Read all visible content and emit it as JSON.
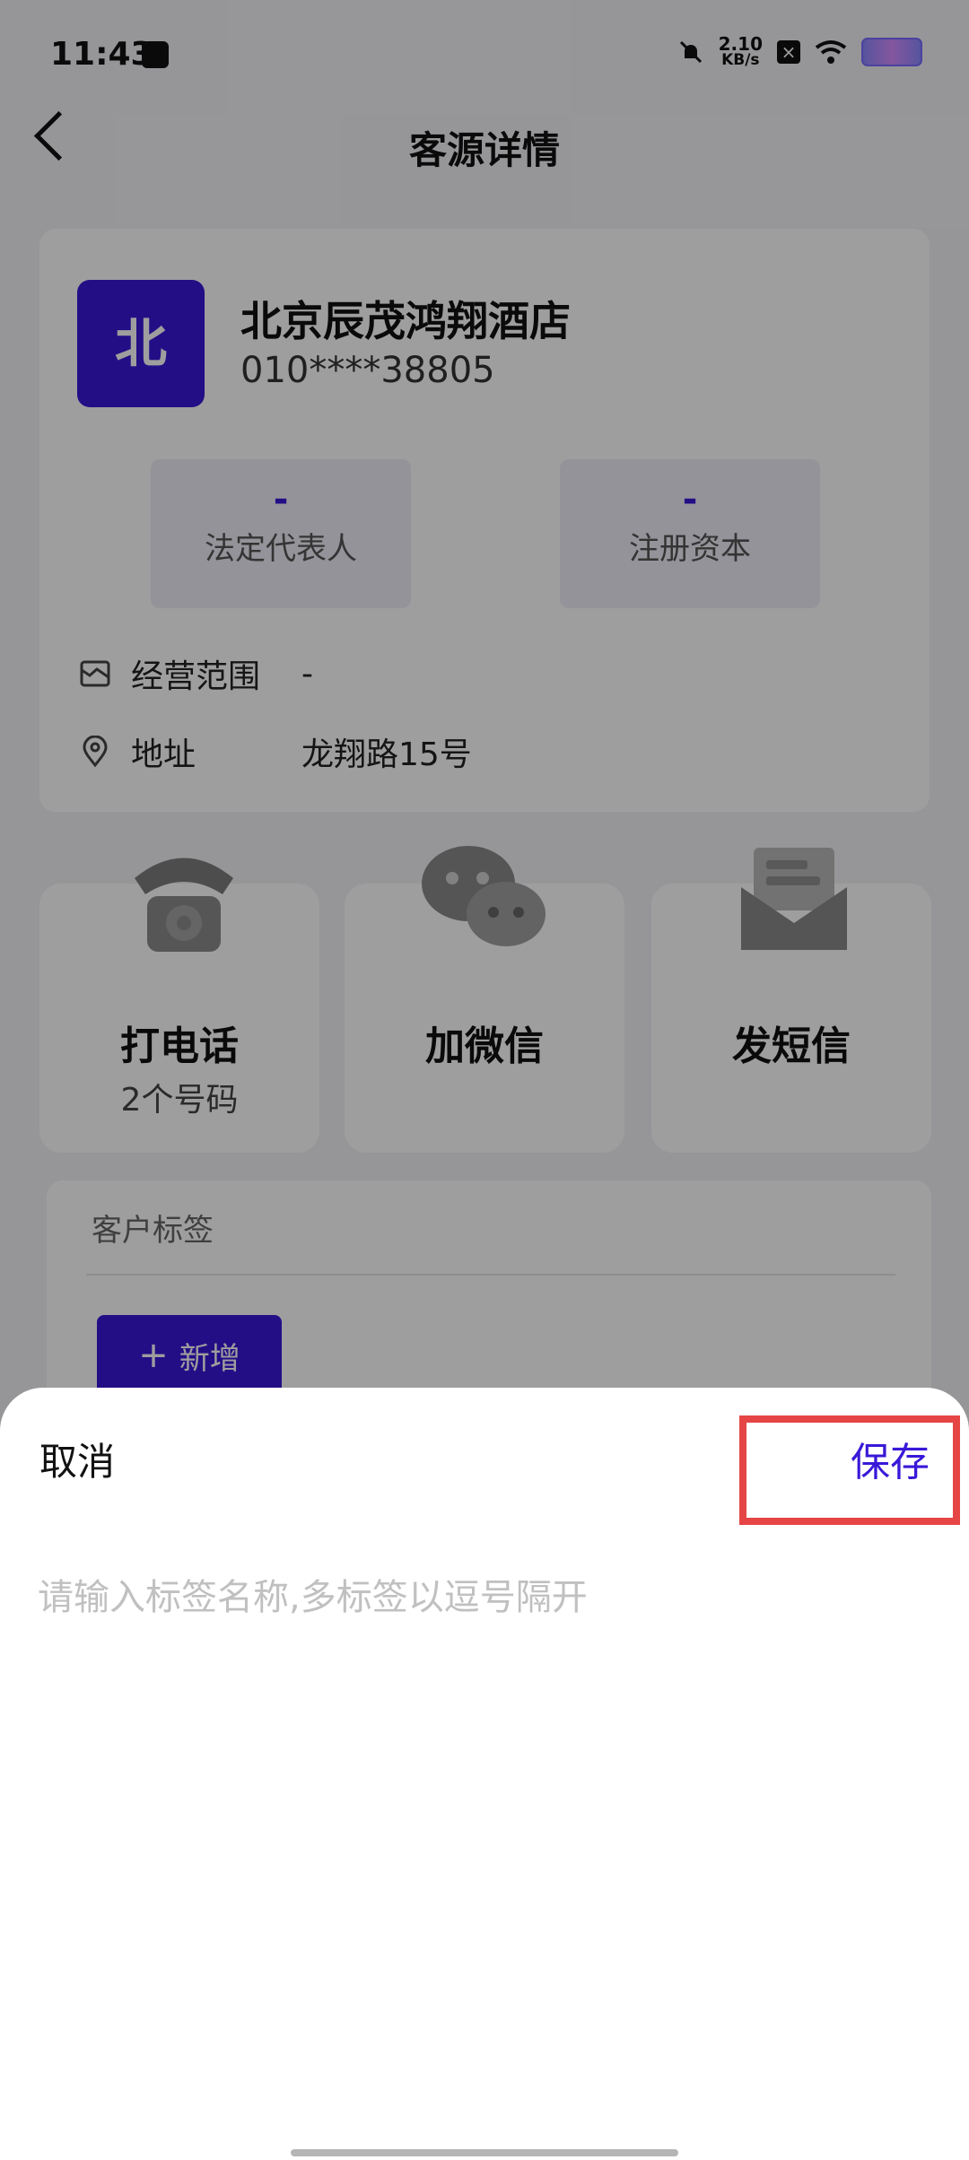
{
  "status": {
    "time": "11:43",
    "net_speed": "2.10",
    "net_unit": "KB/s"
  },
  "header": {
    "title": "客源详情"
  },
  "company": {
    "avatar_text": "北",
    "name": "北京辰茂鸿翔酒店",
    "phone": "010****38805",
    "stats": [
      {
        "value": "-",
        "label": "法定代表人"
      },
      {
        "value": "-",
        "label": "注册资本"
      }
    ],
    "business_scope": {
      "label": "经营范围",
      "value": "-"
    },
    "address": {
      "label": "地址",
      "value": "龙翔路15号"
    }
  },
  "actions": [
    {
      "label": "打电话",
      "sub": "2个号码"
    },
    {
      "label": "加微信",
      "sub": ""
    },
    {
      "label": "发短信",
      "sub": ""
    }
  ],
  "tags": {
    "title": "客户标签",
    "add_label": "新增"
  },
  "sheet": {
    "cancel_label": "取消",
    "save_label": "保存",
    "input_placeholder": "请输入标签名称,多标签以逗号隔开",
    "input_value": ""
  },
  "colors": {
    "accent": "#3a18d8",
    "highlight": "#e64545"
  }
}
